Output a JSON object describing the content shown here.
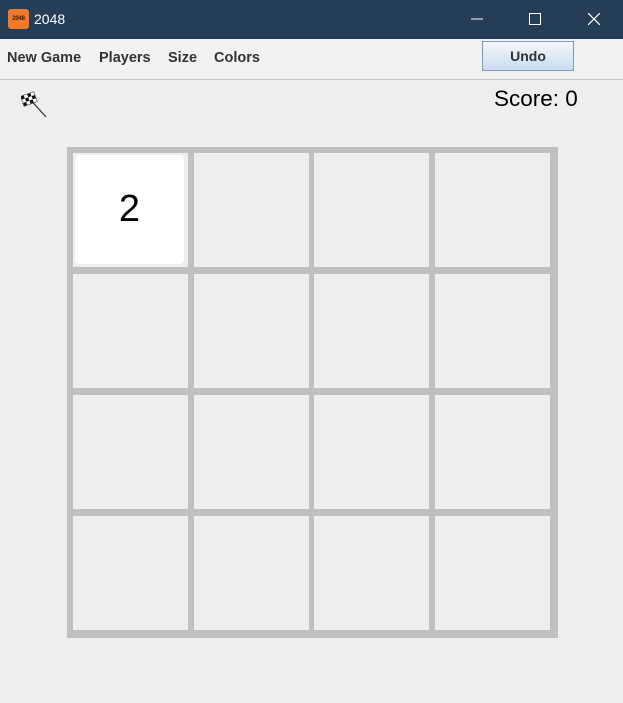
{
  "window": {
    "title": "2048",
    "icon_text": "2048",
    "icon_color": "#f07a2a",
    "titlebar_color": "#253e55"
  },
  "menu": {
    "items": [
      "New Game",
      "Players",
      "Size",
      "Colors"
    ]
  },
  "toolbar": {
    "undo_label": "Undo"
  },
  "status": {
    "score_text": "Score: 0",
    "flag_icon": "checkered-flag-icon"
  },
  "board": {
    "size": 4,
    "tiles": [
      [
        "2",
        "",
        "",
        ""
      ],
      [
        "",
        "",
        "",
        ""
      ],
      [
        "",
        "",
        "",
        ""
      ],
      [
        "",
        "",
        "",
        ""
      ]
    ],
    "tile_2_color": "#ffffff",
    "grid_color": "#c0c0c0",
    "empty_color": "#eeeeee"
  }
}
